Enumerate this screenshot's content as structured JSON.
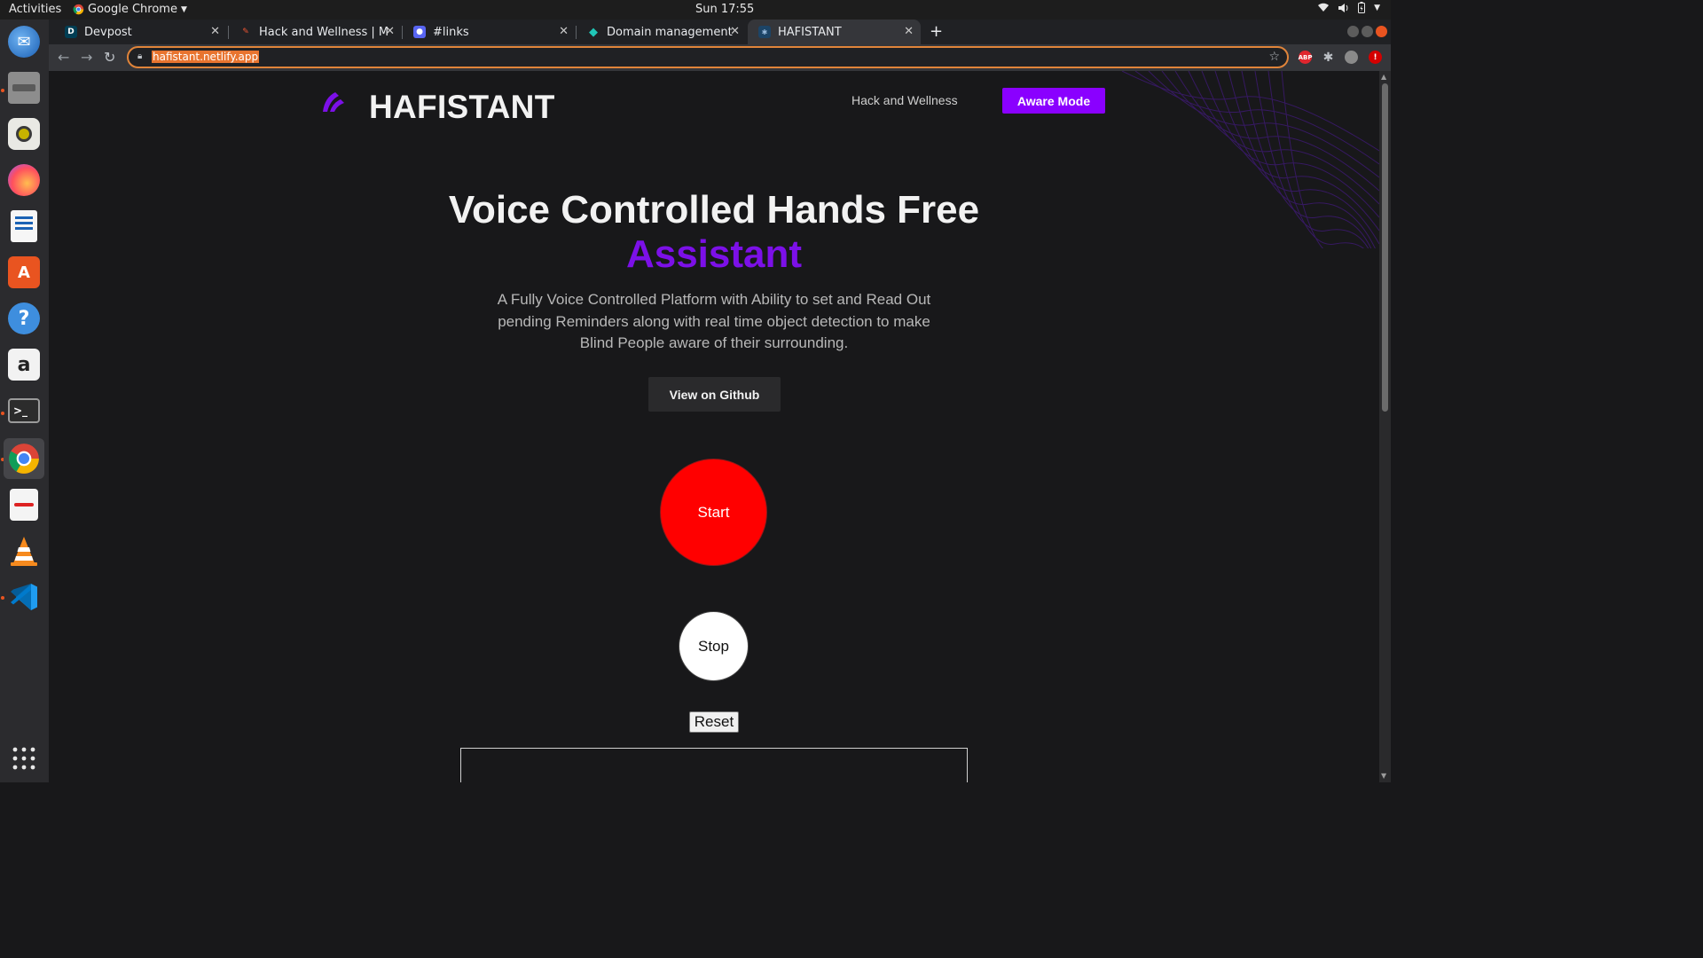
{
  "system": {
    "activities": "Activities",
    "app_name": "Google Chrome",
    "clock": "Sun 17:55"
  },
  "browser": {
    "tabs": [
      {
        "title": "Devpost",
        "favicon": "devpost-icon"
      },
      {
        "title": "Hack and Wellness | Majo",
        "favicon": "hackathon-icon"
      },
      {
        "title": "#links",
        "favicon": "discord-icon"
      },
      {
        "title": "Domain management | Sl",
        "favicon": "netlify-icon"
      },
      {
        "title": "HAFISTANT",
        "favicon": "hafistant-icon",
        "active": true
      }
    ],
    "url": "hafistant.netlify.app"
  },
  "page": {
    "brand": "HAFISTANT",
    "nav_link": "Hack and Wellness",
    "aware_button": "Aware Mode",
    "headline_line1": "Voice Controlled Hands Free",
    "headline_line2": "Assistant",
    "description": "A Fully Voice Controlled Platform with Ability to set and Read Out pending Reminders along with real time object detection to make Blind People aware of their surrounding.",
    "github_button": "View on Github",
    "start_button": "Start",
    "stop_button": "Stop",
    "reset_button": "Reset",
    "transcript": ""
  },
  "colors": {
    "accent": "#8a00ff",
    "headline_accent": "#7c10e8",
    "start": "#ff0000",
    "background": "#18181a"
  }
}
